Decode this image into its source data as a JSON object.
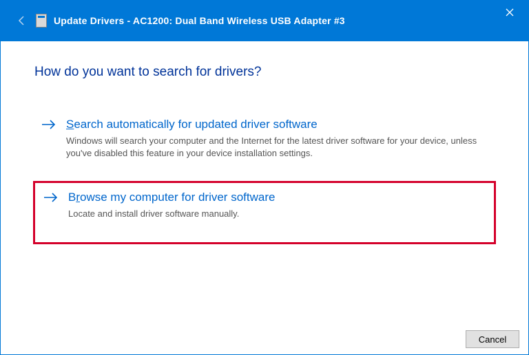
{
  "titlebar": {
    "title": "Update Drivers - AC1200: Dual Band Wireless USB Adapter #3"
  },
  "heading": "How do you want to search for drivers?",
  "options": {
    "search": {
      "title_prefix": "S",
      "title_rest": "earch automatically for updated driver software",
      "desc": "Windows will search your computer and the Internet for the latest driver software for your device, unless you've disabled this feature in your device installation settings."
    },
    "browse": {
      "title_before": "B",
      "title_underline": "r",
      "title_after": "owse my computer for driver software",
      "desc": "Locate and install driver software manually."
    }
  },
  "buttons": {
    "cancel": "Cancel"
  }
}
